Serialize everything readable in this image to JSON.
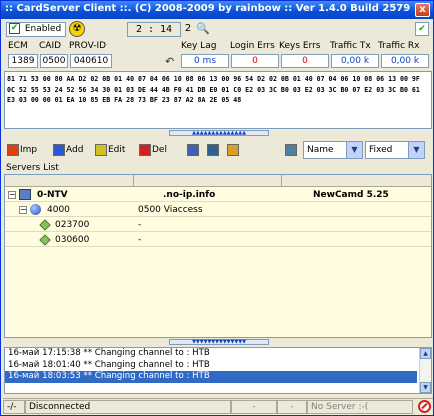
{
  "window": {
    "title": ":: CardServer Client ::. (C) 2008-2009 by rainbow :: Ver 1.4.0 Build 2579",
    "close_label": "x"
  },
  "controls": {
    "enabled_label": "Enabled",
    "enabled_checked": true,
    "time": "2 : 14",
    "counter": "2"
  },
  "stats": {
    "ecm_label": "ECM",
    "caid_label": "CAID",
    "provid_label": "PROV-ID",
    "keylag_label": "Key Lag",
    "loginerrs_label": "Login Errs",
    "keyserrs_label": "Keys Errs",
    "traffictx_label": "Traffic Tx",
    "trafficrx_label": "Traffic Rx",
    "ecm": "1389",
    "caid": "0500",
    "provid": "040610",
    "keylag": "0 ms",
    "loginerrs": "0",
    "keyserrs": "0",
    "traffictx": "0,00 k",
    "trafficrx": "0,00 k"
  },
  "hex_dump": "81 71 53 00 80 AA D2 02 0B 01 40 07 04 06 10 08 06 13 00 96 54 D2 02 0B 01 40 07 04 06 10 08 06 13 00 9F 0C 52 55 53 24 52 56 34 30 01 03 DE 44 4B F0 41 DB E0 01 C0 E2 03 3C B0 03 E2 03 3C B0 07 E2 03 3C B0 61 E3 03 00 00 01 EA 10 85 EB FA 28 73 BF 23 87 A2 8A 2E 05 48",
  "toolbar": {
    "imp_label": "Imp",
    "add_label": "Add",
    "edit_label": "Edit",
    "del_label": "Del",
    "sort_select": "Name",
    "layout_select": "Fixed"
  },
  "servers": {
    "label": "Servers List",
    "rows": [
      {
        "name": "0-NTV",
        "host": ".no-ip.info",
        "protocol": "NewCamd 5.25"
      },
      {
        "name": "4000",
        "host": "0500 Viaccess",
        "protocol": ""
      },
      {
        "name": "023700",
        "host": "-",
        "protocol": ""
      },
      {
        "name": "030600",
        "host": "-",
        "protocol": ""
      }
    ]
  },
  "log": [
    "16-май 17:15:38 ** Changing channel to : НТВ",
    "16-май 18:01:40 ** Changing channel to : НТВ",
    "16-май 18:03:53 ** Changing channel to : НТВ"
  ],
  "status": {
    "indicator": "-/-",
    "connection": "Disconnected",
    "cell_a": "-",
    "cell_b": "-",
    "server": "No Server :-("
  }
}
